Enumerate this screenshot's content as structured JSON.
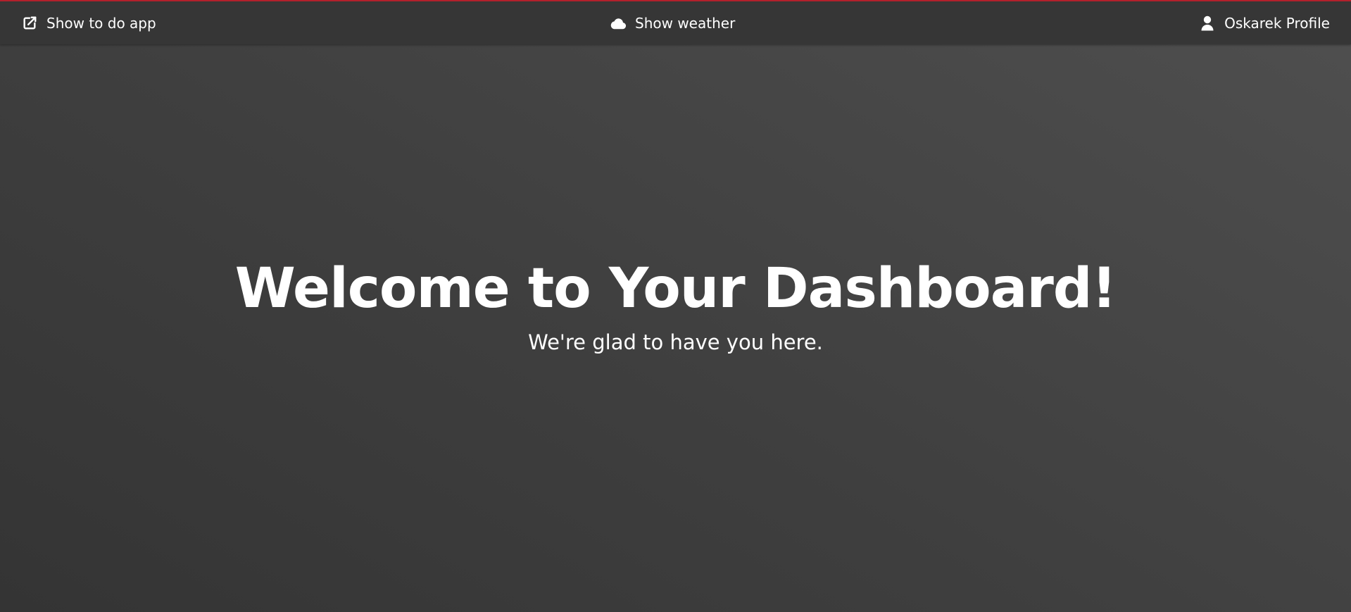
{
  "colors": {
    "accent_border": "#b3202c",
    "topbar_bg": "#363636",
    "text": "#ffffff"
  },
  "topbar": {
    "todo": {
      "label": "Show to do app",
      "icon": "external-link-icon"
    },
    "weather": {
      "label": "Show weather",
      "icon": "cloud-icon"
    },
    "profile": {
      "label": "Oskarek Profile",
      "icon": "user-icon"
    }
  },
  "hero": {
    "title": "Welcome to Your Dashboard!",
    "subtitle": "We're glad to have you here."
  }
}
